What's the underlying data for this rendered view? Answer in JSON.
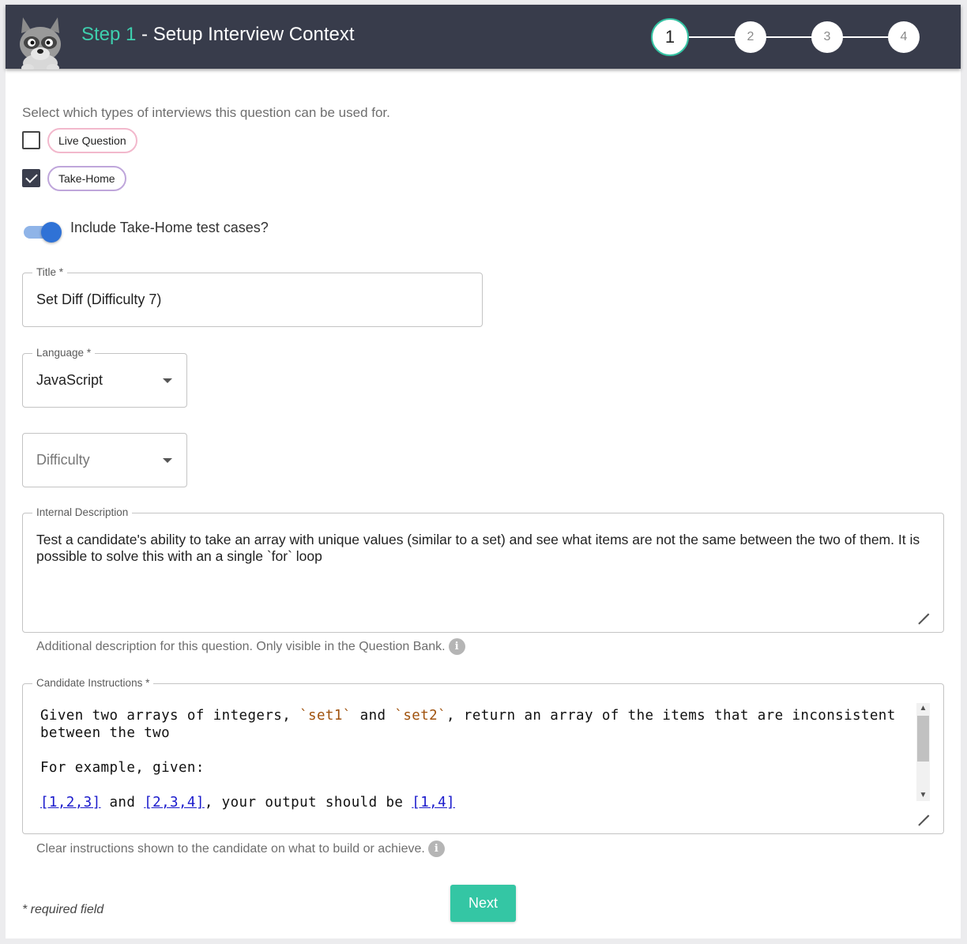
{
  "header": {
    "step_prefix": "Step 1",
    "title_suffix": " - Setup Interview Context",
    "steps": [
      "1",
      "2",
      "3",
      "4"
    ]
  },
  "form": {
    "intro": "Select which types of interviews this question can be used for.",
    "interview_types": [
      {
        "label": "Live Question",
        "checked": false
      },
      {
        "label": "Take-Home",
        "checked": true
      }
    ],
    "toggle": {
      "label": "Include Take-Home test cases?",
      "on": true
    },
    "title_field": {
      "label": "Title *",
      "value": "Set Diff (Difficulty 7)"
    },
    "language_field": {
      "label": "Language *",
      "value": "JavaScript"
    },
    "difficulty_field": {
      "placeholder": "Difficulty"
    },
    "internal_description": {
      "label": "Internal Description",
      "value": "Test a candidate's ability to take an array with unique values (similar to a set) and see what items are not the same between the two of them. It is possible to solve this with an a single `for` loop",
      "helper": "Additional description for this question. Only visible in the Question Bank."
    },
    "candidate_instructions": {
      "label": "Candidate Instructions *",
      "line1_a": "Given two arrays of integers, ",
      "code1": "`set1`",
      "line1_b": " and ",
      "code2": "`set2`",
      "line1_c": ", return an array of the items that are inconsistent between the two",
      "line2": "For example, given:",
      "ex_set1": "[1,2,3]",
      "ex_and": " and ",
      "ex_set2": "[2,3,4]",
      "ex_mid": ", your output should be ",
      "ex_result": "[1,4]",
      "helper": "Clear instructions shown to the candidate on what to build or achieve."
    },
    "required_note": "* required field",
    "next_label": "Next"
  },
  "icons": {
    "info": "info-icon",
    "dropdown": "caret-down-icon",
    "mascot": "raccoon-mascot-icon"
  },
  "colors": {
    "header_bg": "#383c4b",
    "accent": "#34c6a4",
    "toggle": "#2f72d6"
  }
}
